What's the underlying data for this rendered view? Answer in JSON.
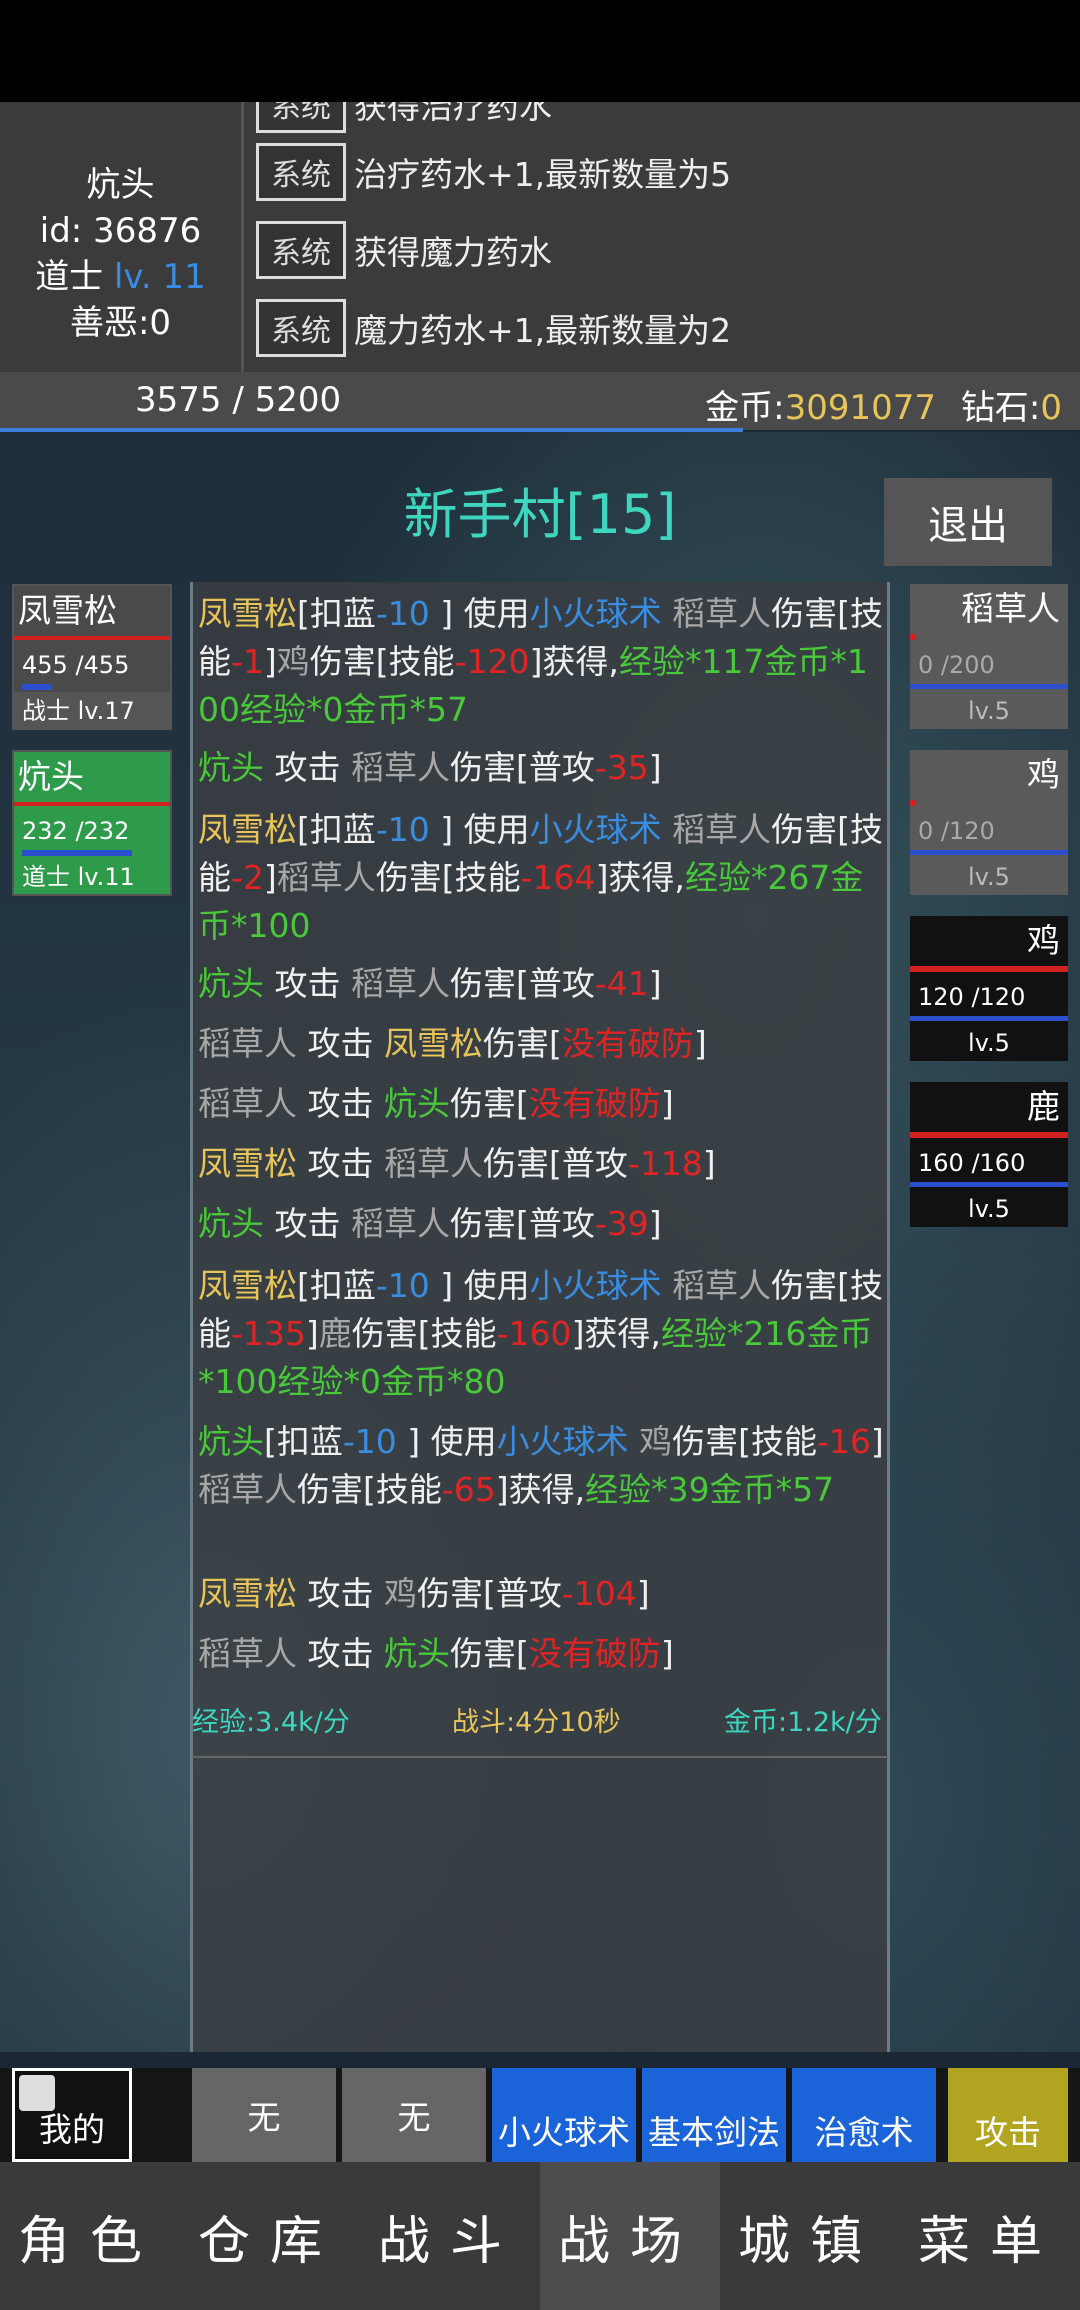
{
  "player": {
    "name": "炕头",
    "id_text": "id: 36876",
    "class": "道士",
    "level_text": "lv. 11",
    "karma_text": "善恶:0"
  },
  "system_log": [
    {
      "badge": "系统",
      "text": "获得治疗药水"
    },
    {
      "badge": "系统",
      "text": "治疗药水+1,最新数量为5"
    },
    {
      "badge": "系统",
      "text": "获得魔力药水"
    },
    {
      "badge": "系统",
      "text": "魔力药水+1,最新数量为2"
    }
  ],
  "exp": {
    "text": "3575 / 5200",
    "fraction": 0.6875
  },
  "currency": {
    "gold_label": "金币:",
    "gold_value": "3091077",
    "diamond_label": "钻石:",
    "diamond_value": "0"
  },
  "map": {
    "title": "新手村[15]",
    "exit_label": "退出"
  },
  "allies": [
    {
      "name": "凤雪松",
      "hp": "455 /455",
      "level": "战士 lv.17"
    },
    {
      "name": "炕头",
      "hp": "232 /232",
      "level": "道士 lv.11"
    }
  ],
  "enemies": [
    {
      "name": "稻草人",
      "hp": "0 /200",
      "level": "lv.5"
    },
    {
      "name": "鸡",
      "hp": "0 /120",
      "level": "lv.5"
    },
    {
      "name": "鸡",
      "hp": "120 /120",
      "level": "lv.5"
    },
    {
      "name": "鹿",
      "hp": "160 /160",
      "level": "lv.5"
    }
  ],
  "battle_log": [
    [
      [
        "y",
        "凤雪松"
      ],
      [
        "w",
        "[扣蓝"
      ],
      [
        "b",
        "-10"
      ],
      [
        "w",
        " ] 使用"
      ],
      [
        "b",
        "小火球术"
      ],
      [
        "gr",
        " 稻草人"
      ],
      [
        "w",
        "伤害[技能"
      ],
      [
        "r",
        "-1"
      ],
      [
        "w",
        "]"
      ],
      [
        "gr",
        "鸡"
      ],
      [
        "w",
        "伤害[技能"
      ],
      [
        "r",
        "-120"
      ],
      [
        "w",
        "]获得,"
      ],
      [
        "g",
        "经验*117金币*100经验*0金币*57"
      ]
    ],
    [
      [
        "g",
        "炕头"
      ],
      [
        "w",
        " 攻击 "
      ],
      [
        "gr",
        "稻草人"
      ],
      [
        "w",
        "伤害[普攻"
      ],
      [
        "r",
        "-35"
      ],
      [
        "w",
        "]"
      ]
    ],
    [
      [
        "y",
        "凤雪松"
      ],
      [
        "w",
        "[扣蓝"
      ],
      [
        "b",
        "-10"
      ],
      [
        "w",
        " ] 使用"
      ],
      [
        "b",
        "小火球术"
      ],
      [
        "gr",
        " 稻草人"
      ],
      [
        "w",
        "伤害[技能"
      ],
      [
        "r",
        "-2"
      ],
      [
        "w",
        "]"
      ],
      [
        "gr",
        "稻草人"
      ],
      [
        "w",
        "伤害[技能"
      ],
      [
        "r",
        "-164"
      ],
      [
        "w",
        "]获得,"
      ],
      [
        "g",
        "经验*267金币*100"
      ]
    ],
    [
      [
        "g",
        "炕头"
      ],
      [
        "w",
        " 攻击 "
      ],
      [
        "gr",
        "稻草人"
      ],
      [
        "w",
        "伤害[普攻"
      ],
      [
        "r",
        "-41"
      ],
      [
        "w",
        "]"
      ]
    ],
    [
      [
        "gr",
        "稻草人"
      ],
      [
        "w",
        " 攻击 "
      ],
      [
        "y",
        "凤雪松"
      ],
      [
        "w",
        "伤害["
      ],
      [
        "r",
        "没有破防"
      ],
      [
        "w",
        "]"
      ]
    ],
    [
      [
        "gr",
        "稻草人"
      ],
      [
        "w",
        " 攻击 "
      ],
      [
        "g",
        "炕头"
      ],
      [
        "w",
        "伤害["
      ],
      [
        "r",
        "没有破防"
      ],
      [
        "w",
        "]"
      ]
    ],
    [
      [
        "y",
        "凤雪松"
      ],
      [
        "w",
        " 攻击 "
      ],
      [
        "gr",
        "稻草人"
      ],
      [
        "w",
        "伤害[普攻"
      ],
      [
        "r",
        "-118"
      ],
      [
        "w",
        "]"
      ]
    ],
    [
      [
        "g",
        "炕头"
      ],
      [
        "w",
        " 攻击 "
      ],
      [
        "gr",
        "稻草人"
      ],
      [
        "w",
        "伤害[普攻"
      ],
      [
        "r",
        "-39"
      ],
      [
        "w",
        "]"
      ]
    ],
    [
      [
        "y",
        "凤雪松"
      ],
      [
        "w",
        "[扣蓝"
      ],
      [
        "b",
        "-10"
      ],
      [
        "w",
        " ] 使用"
      ],
      [
        "b",
        "小火球术"
      ],
      [
        "gr",
        " 稻草人"
      ],
      [
        "w",
        "伤害[技能"
      ],
      [
        "r",
        "-135"
      ],
      [
        "w",
        "]"
      ],
      [
        "gr",
        "鹿"
      ],
      [
        "w",
        "伤害[技能"
      ],
      [
        "r",
        "-160"
      ],
      [
        "w",
        "]获得,"
      ],
      [
        "g",
        "经验*216金币*100经验*0金币*80"
      ]
    ],
    [
      [
        "g",
        "炕头"
      ],
      [
        "w",
        "[扣蓝"
      ],
      [
        "b",
        "-10"
      ],
      [
        "w",
        " ] 使用"
      ],
      [
        "b",
        "小火球术"
      ],
      [
        "gr",
        " 鸡"
      ],
      [
        "w",
        "伤害[技能"
      ],
      [
        "r",
        "-16"
      ],
      [
        "w",
        "]"
      ],
      [
        "gr",
        "稻草人"
      ],
      [
        "w",
        "伤害[技能"
      ],
      [
        "r",
        "-65"
      ],
      [
        "w",
        "]获得,"
      ],
      [
        "g",
        "经验*39金币*57"
      ]
    ],
    [
      [
        "y",
        "凤雪松"
      ],
      [
        "w",
        " 攻击 "
      ],
      [
        "gr",
        "鸡"
      ],
      [
        "w",
        "伤害[普攻"
      ],
      [
        "r",
        "-104"
      ],
      [
        "w",
        "]"
      ]
    ],
    [
      [
        "gr",
        "稻草人"
      ],
      [
        "w",
        " 攻击 "
      ],
      [
        "g",
        "炕头"
      ],
      [
        "w",
        "伤害["
      ],
      [
        "r",
        "没有破防"
      ],
      [
        "w",
        "]"
      ]
    ]
  ],
  "stats": {
    "exp_rate": "经验:3.4k/分",
    "battle_time": "战斗:4分10秒",
    "gold_rate": "金币:1.2k/分"
  },
  "skills": {
    "mine": "我的",
    "slot1": "无",
    "slot2": "无",
    "s1": "小火球术",
    "s2": "基本剑法",
    "s3": "治愈术",
    "attack": "攻击"
  },
  "nav": [
    "角色",
    "仓库",
    "战斗",
    "战场",
    "城镇",
    "菜单"
  ],
  "colors": {
    "accent": "#3fd6c0",
    "gold": "#e8c55a",
    "skill_blue": "#1a63d8",
    "attack_yellow": "#b1a421",
    "ally_green": "#2e9b4a"
  }
}
